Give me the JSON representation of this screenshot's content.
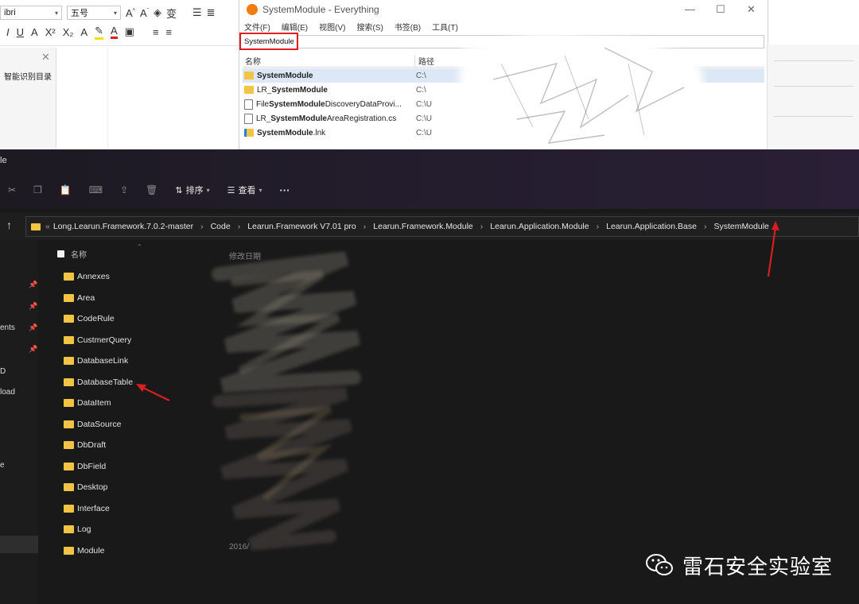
{
  "word": {
    "font_name": "ibri",
    "font_size": "五号",
    "nav_pane_label": "智能识别目录"
  },
  "everything": {
    "title": "SystemModule - Everything",
    "menu": [
      "文件(F)",
      "编辑(E)",
      "视图(V)",
      "搜索(S)",
      "书签(B)",
      "工具(T)"
    ],
    "search_value": "SystemModule",
    "columns": [
      "名称",
      "路径"
    ],
    "results": [
      {
        "pre": "",
        "bold": "SystemModule",
        "post": "",
        "path": "C:\\",
        "icon": "folder-icon",
        "selected": true
      },
      {
        "pre": "LR_",
        "bold": "SystemModule",
        "post": "",
        "path": "C:\\",
        "icon": "folder-icon",
        "selected": false
      },
      {
        "pre": "File",
        "bold": "SystemModule",
        "post": "DiscoveryDataProvi...",
        "path": "C:\\U",
        "icon": "file-icon",
        "selected": false
      },
      {
        "pre": "LR_",
        "bold": "SystemModule",
        "post": "AreaRegistration.cs",
        "path": "C:\\U",
        "icon": "file-icon",
        "selected": false
      },
      {
        "pre": "",
        "bold": "SystemModule",
        "post": ".lnk",
        "path": "C:\\U",
        "icon": "shortcut-icon",
        "selected": false
      }
    ]
  },
  "explorer": {
    "title": "le",
    "toolbar": {
      "sort_label": "排序",
      "view_label": "查看",
      "more_label": "···"
    },
    "address_prefix": "«",
    "path": [
      "Long.Learun.Framework.7.0.2-master",
      "Code",
      "Learun.Framework V7.01 pro",
      "Learun.Framework.Module",
      "Learun.Application.Module",
      "Learun.Application.Base",
      "SystemModule"
    ],
    "name_header": "名称",
    "date_header": "修改日期",
    "nav_items": [
      "ents",
      "D",
      "load",
      "e"
    ],
    "folders": [
      "Annexes",
      "Area",
      "CodeRule",
      "CustmerQuery",
      "DatabaseLink",
      "DatabaseTable",
      "DataItem",
      "DataSource",
      "DbDraft",
      "DbField",
      "Desktop",
      "Interface",
      "Log",
      "Module"
    ],
    "last_date_fragment": "2016/"
  },
  "watermark": {
    "text": "雷石安全实验室"
  },
  "colors": {
    "highlight_red": "#e02020",
    "folder_yellow": "#f3c444",
    "everything_orange": "#f07c12"
  }
}
